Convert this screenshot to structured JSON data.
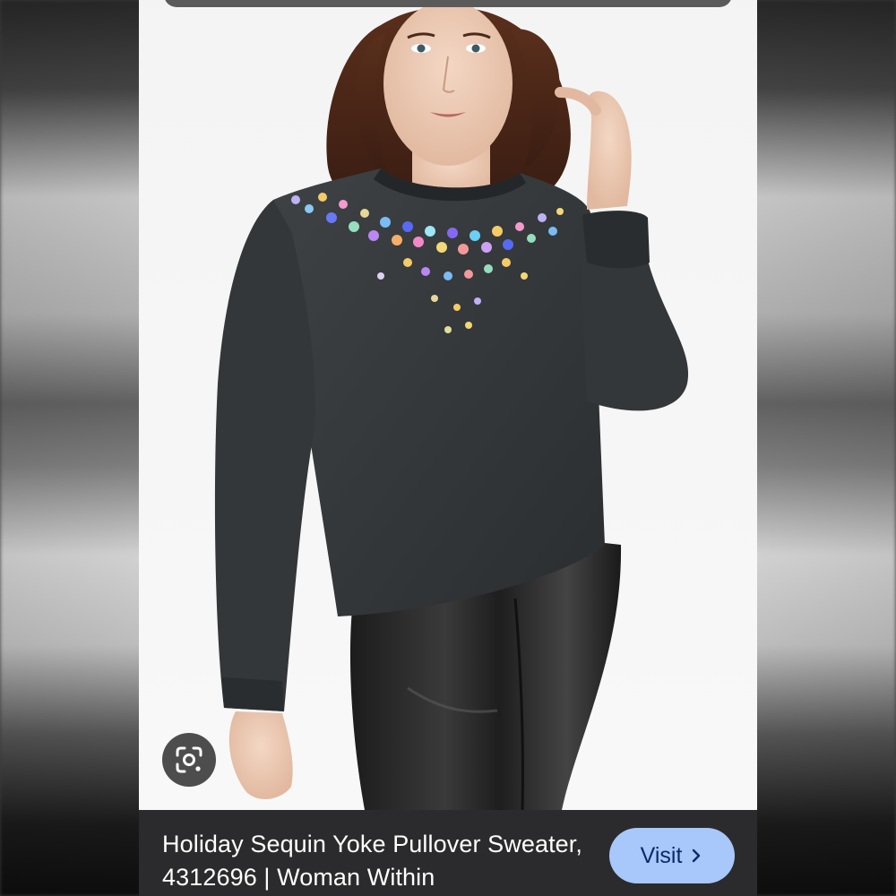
{
  "result": {
    "title": "Holiday Sequin Yoke Pullover Sweater, 4312696 | Woman Within",
    "visit_label": "Visit",
    "visit_icon": "chevron-right-icon"
  },
  "overlay": {
    "lens_icon": "google-lens-icon"
  },
  "colors": {
    "caption_background": "#2b2b2e",
    "visit_button": "#a8c7fa",
    "visit_text": "#0b2a66"
  }
}
